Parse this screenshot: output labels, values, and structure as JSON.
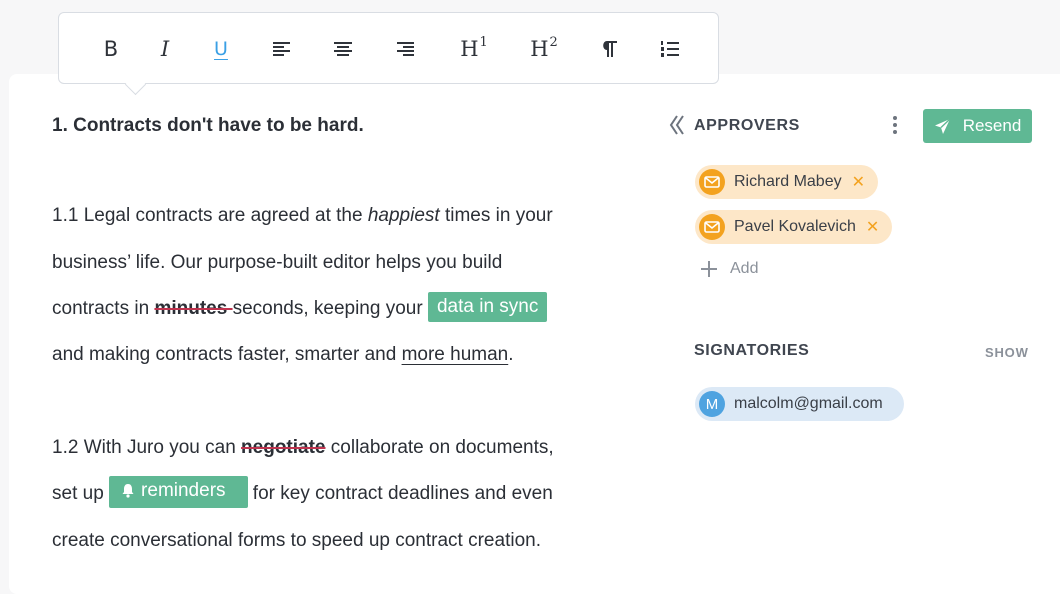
{
  "toolbar": {
    "bold": "B",
    "italic": "I",
    "underline": "U",
    "h1": "H",
    "h1_sup": "1",
    "h2": "H",
    "h2_sup": "2",
    "icons": [
      "bold-icon",
      "italic-icon",
      "underline-icon",
      "align-left-icon",
      "align-center-icon",
      "align-right-icon",
      "heading-1-icon",
      "heading-2-icon",
      "paragraph-icon",
      "numbered-list-icon"
    ]
  },
  "doc": {
    "heading": "1. Contracts don't have to be hard.",
    "p1_l1_a": "1.1 Legal contracts are agreed at the ",
    "p1_l1_em": "happiest",
    "p1_l1_b": " times in your",
    "p1_l2": "business’ life. Our purpose-built editor helps you build",
    "p1_l3_a": "contracts in ",
    "p1_l3_strike": "minutes ",
    "p1_l3_b": "seconds, keeping your ",
    "p1_l3_chip": "data in sync",
    "p1_l4_a": "and making contracts faster, smarter and ",
    "p1_l4_u": "more human",
    "p1_l4_b": ".",
    "p2_l1_a": "1.2 With Juro you can ",
    "p2_l1_strike": "negotiate",
    "p2_l1_b": " collaborate on documents,",
    "p2_l2_a": "set up ",
    "p2_l2_chip": "reminders",
    "p2_l2_b": "  for key contract deadlines and even",
    "p2_l3": "create conversational forms to speed up contract creation."
  },
  "sidebar": {
    "approvers_title": "APPROVERS",
    "resend_label": "Resend",
    "approvers": [
      {
        "name": "Richard Mabey"
      },
      {
        "name": "Pavel Kovalevich"
      }
    ],
    "add_label": "Add",
    "signatories_title": "SIGNATORIES",
    "show_label": "SHOW",
    "signatories": [
      {
        "initial": "M",
        "email": "malcolm@gmail.com"
      }
    ]
  },
  "colors": {
    "accent_green": "#5fb894",
    "approver_bg": "#fde7c8",
    "approver_icon": "#f3a21f",
    "signer_bg": "#dce9f6",
    "signer_icon": "#4fa3e0",
    "active_format": "#3aa0e5",
    "strike": "#c0344f"
  }
}
